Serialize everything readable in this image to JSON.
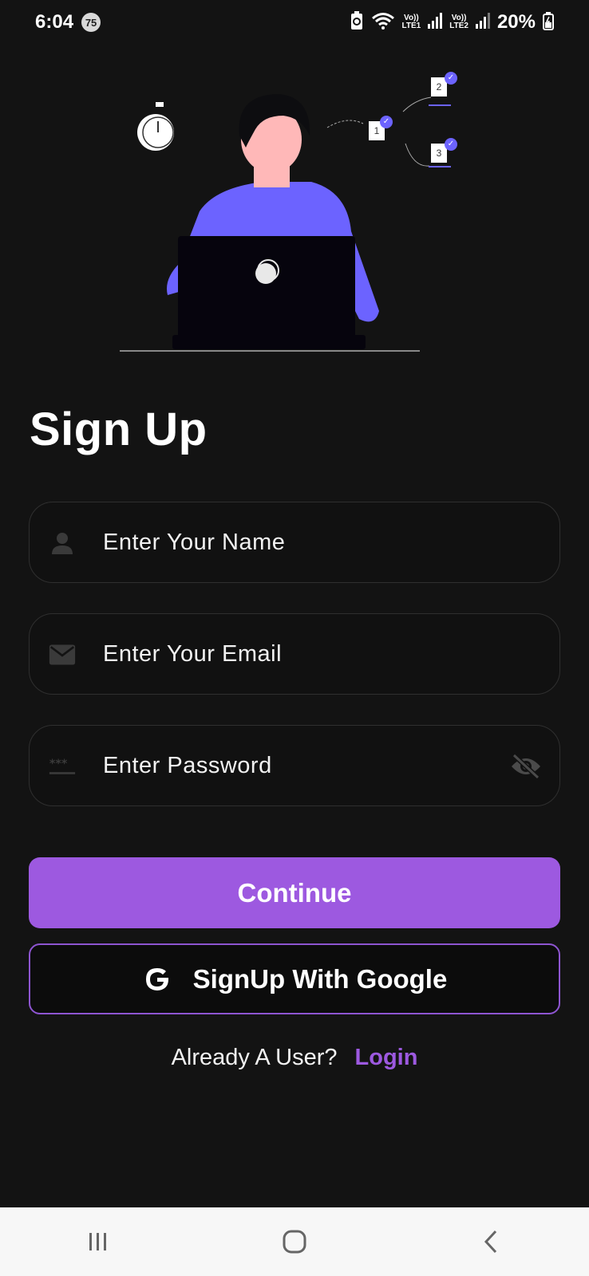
{
  "status": {
    "time": "6:04",
    "badge": "75",
    "net1_top": "Vo))",
    "net1_bottom": "LTE1",
    "net2_top": "Vo))",
    "net2_bottom": "LTE2",
    "battery": "20%"
  },
  "page": {
    "title": "Sign Up"
  },
  "form": {
    "name_placeholder": "Enter Your Name",
    "email_placeholder": "Enter Your Email",
    "password_placeholder": "Enter Password"
  },
  "actions": {
    "continue_label": "Continue",
    "google_label": "SignUp With Google"
  },
  "footer": {
    "prompt": "Already A User?",
    "login_label": "Login"
  },
  "illustration": {
    "steps": [
      "1",
      "2",
      "3"
    ]
  },
  "icons": {
    "name": "person-icon",
    "email": "mail-icon",
    "password": "password-icon",
    "toggle": "eye-off-icon",
    "google": "google-icon"
  },
  "colors": {
    "background": "#131313",
    "accent": "#9d59e0",
    "illustration_purple": "#6c63ff",
    "skin": "#ffb8b8"
  }
}
